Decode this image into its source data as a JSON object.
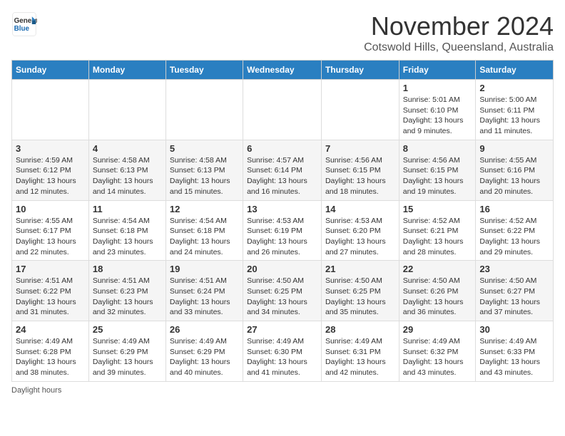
{
  "header": {
    "logo_line1": "General",
    "logo_line2": "Blue",
    "month": "November 2024",
    "location": "Cotswold Hills, Queensland, Australia"
  },
  "days_of_week": [
    "Sunday",
    "Monday",
    "Tuesday",
    "Wednesday",
    "Thursday",
    "Friday",
    "Saturday"
  ],
  "weeks": [
    [
      {
        "date": "",
        "info": ""
      },
      {
        "date": "",
        "info": ""
      },
      {
        "date": "",
        "info": ""
      },
      {
        "date": "",
        "info": ""
      },
      {
        "date": "",
        "info": ""
      },
      {
        "date": "1",
        "info": "Sunrise: 5:01 AM\nSunset: 6:10 PM\nDaylight: 13 hours and 9 minutes."
      },
      {
        "date": "2",
        "info": "Sunrise: 5:00 AM\nSunset: 6:11 PM\nDaylight: 13 hours and 11 minutes."
      }
    ],
    [
      {
        "date": "3",
        "info": "Sunrise: 4:59 AM\nSunset: 6:12 PM\nDaylight: 13 hours and 12 minutes."
      },
      {
        "date": "4",
        "info": "Sunrise: 4:58 AM\nSunset: 6:13 PM\nDaylight: 13 hours and 14 minutes."
      },
      {
        "date": "5",
        "info": "Sunrise: 4:58 AM\nSunset: 6:13 PM\nDaylight: 13 hours and 15 minutes."
      },
      {
        "date": "6",
        "info": "Sunrise: 4:57 AM\nSunset: 6:14 PM\nDaylight: 13 hours and 16 minutes."
      },
      {
        "date": "7",
        "info": "Sunrise: 4:56 AM\nSunset: 6:15 PM\nDaylight: 13 hours and 18 minutes."
      },
      {
        "date": "8",
        "info": "Sunrise: 4:56 AM\nSunset: 6:15 PM\nDaylight: 13 hours and 19 minutes."
      },
      {
        "date": "9",
        "info": "Sunrise: 4:55 AM\nSunset: 6:16 PM\nDaylight: 13 hours and 20 minutes."
      }
    ],
    [
      {
        "date": "10",
        "info": "Sunrise: 4:55 AM\nSunset: 6:17 PM\nDaylight: 13 hours and 22 minutes."
      },
      {
        "date": "11",
        "info": "Sunrise: 4:54 AM\nSunset: 6:18 PM\nDaylight: 13 hours and 23 minutes."
      },
      {
        "date": "12",
        "info": "Sunrise: 4:54 AM\nSunset: 6:18 PM\nDaylight: 13 hours and 24 minutes."
      },
      {
        "date": "13",
        "info": "Sunrise: 4:53 AM\nSunset: 6:19 PM\nDaylight: 13 hours and 26 minutes."
      },
      {
        "date": "14",
        "info": "Sunrise: 4:53 AM\nSunset: 6:20 PM\nDaylight: 13 hours and 27 minutes."
      },
      {
        "date": "15",
        "info": "Sunrise: 4:52 AM\nSunset: 6:21 PM\nDaylight: 13 hours and 28 minutes."
      },
      {
        "date": "16",
        "info": "Sunrise: 4:52 AM\nSunset: 6:22 PM\nDaylight: 13 hours and 29 minutes."
      }
    ],
    [
      {
        "date": "17",
        "info": "Sunrise: 4:51 AM\nSunset: 6:22 PM\nDaylight: 13 hours and 31 minutes."
      },
      {
        "date": "18",
        "info": "Sunrise: 4:51 AM\nSunset: 6:23 PM\nDaylight: 13 hours and 32 minutes."
      },
      {
        "date": "19",
        "info": "Sunrise: 4:51 AM\nSunset: 6:24 PM\nDaylight: 13 hours and 33 minutes."
      },
      {
        "date": "20",
        "info": "Sunrise: 4:50 AM\nSunset: 6:25 PM\nDaylight: 13 hours and 34 minutes."
      },
      {
        "date": "21",
        "info": "Sunrise: 4:50 AM\nSunset: 6:25 PM\nDaylight: 13 hours and 35 minutes."
      },
      {
        "date": "22",
        "info": "Sunrise: 4:50 AM\nSunset: 6:26 PM\nDaylight: 13 hours and 36 minutes."
      },
      {
        "date": "23",
        "info": "Sunrise: 4:50 AM\nSunset: 6:27 PM\nDaylight: 13 hours and 37 minutes."
      }
    ],
    [
      {
        "date": "24",
        "info": "Sunrise: 4:49 AM\nSunset: 6:28 PM\nDaylight: 13 hours and 38 minutes."
      },
      {
        "date": "25",
        "info": "Sunrise: 4:49 AM\nSunset: 6:29 PM\nDaylight: 13 hours and 39 minutes."
      },
      {
        "date": "26",
        "info": "Sunrise: 4:49 AM\nSunset: 6:29 PM\nDaylight: 13 hours and 40 minutes."
      },
      {
        "date": "27",
        "info": "Sunrise: 4:49 AM\nSunset: 6:30 PM\nDaylight: 13 hours and 41 minutes."
      },
      {
        "date": "28",
        "info": "Sunrise: 4:49 AM\nSunset: 6:31 PM\nDaylight: 13 hours and 42 minutes."
      },
      {
        "date": "29",
        "info": "Sunrise: 4:49 AM\nSunset: 6:32 PM\nDaylight: 13 hours and 43 minutes."
      },
      {
        "date": "30",
        "info": "Sunrise: 4:49 AM\nSunset: 6:33 PM\nDaylight: 13 hours and 43 minutes."
      }
    ]
  ],
  "footer": {
    "note": "Daylight hours"
  }
}
